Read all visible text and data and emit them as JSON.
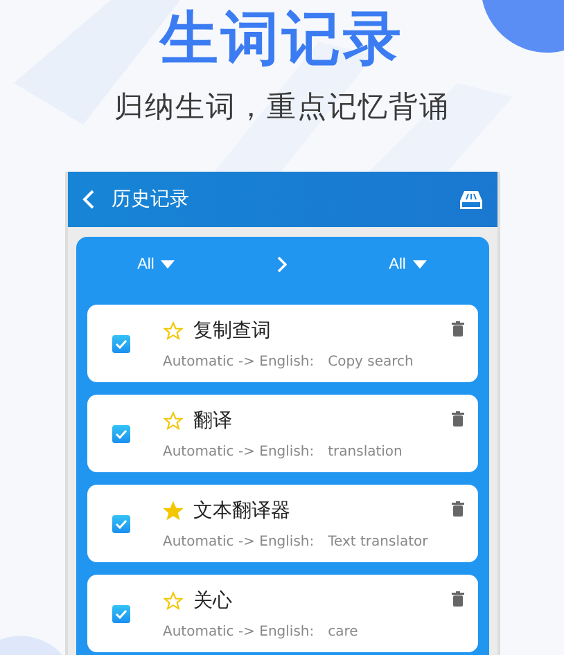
{
  "headline": "生词记录",
  "subtitle": "归纳生词，重点记忆背诵",
  "app": {
    "title": "历史记录",
    "filter": {
      "source": "All",
      "target": "All"
    },
    "entries": [
      {
        "word": "复制查词",
        "direction": "Automatic -> English:",
        "translation": "Copy search",
        "starred": false,
        "checked": true
      },
      {
        "word": "翻译",
        "direction": "Automatic -> English:",
        "translation": "translation",
        "starred": false,
        "checked": true
      },
      {
        "word": "文本翻译器",
        "direction": "Automatic -> English:",
        "translation": "Text translator",
        "starred": true,
        "checked": true
      },
      {
        "word": "关心",
        "direction": "Automatic -> English:",
        "translation": "care",
        "starred": false,
        "checked": true
      }
    ]
  }
}
